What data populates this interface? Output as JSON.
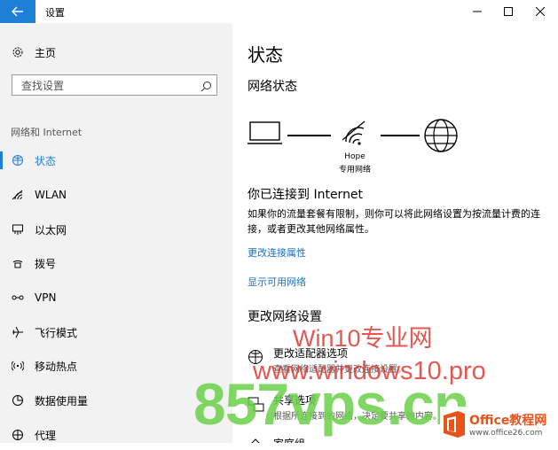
{
  "window": {
    "title": "设置"
  },
  "sidebar": {
    "home_label": "主页",
    "search_placeholder": "查找设置",
    "section_title": "网络和 Internet",
    "items": [
      {
        "label": "状态",
        "icon": "status-icon",
        "selected": true
      },
      {
        "label": "WLAN",
        "icon": "wifi-icon"
      },
      {
        "label": "以太网",
        "icon": "ethernet-icon"
      },
      {
        "label": "拨号",
        "icon": "dialup-icon"
      },
      {
        "label": "VPN",
        "icon": "vpn-icon"
      },
      {
        "label": "飞行模式",
        "icon": "airplane-icon"
      },
      {
        "label": "移动热点",
        "icon": "hotspot-icon"
      },
      {
        "label": "数据使用量",
        "icon": "data-usage-icon"
      },
      {
        "label": "代理",
        "icon": "proxy-icon"
      }
    ]
  },
  "main": {
    "page_title": "状态",
    "network_status_heading": "网络状态",
    "network_name": "Hope",
    "network_type": "专用网络",
    "connected_heading": "你已连接到 Internet",
    "connected_desc": "如果你的流量套餐有限制，则你可以将此网络设置为按流量计费的连接，或者更改其他网络属性。",
    "link_change_properties": "更改连接属性",
    "link_show_networks": "显示可用网络",
    "change_settings_heading": "更改网络设置",
    "options": [
      {
        "title": "更改适配器选项",
        "desc": "查看网络适配器并更改连接设置。",
        "icon": "adapter-icon"
      },
      {
        "title": "共享选项",
        "desc": "根据所连接到的网络，决定要共享的内容。",
        "icon": "sharing-icon"
      },
      {
        "title": "家庭组",
        "icon": "homegroup-icon"
      }
    ]
  },
  "watermark": {
    "line1": "Win10专业网",
    "line2": "www.windows10.pro",
    "line3": "857vps.cn",
    "brand_name": "Office教程网",
    "brand_url": "www.office26.com"
  },
  "colors": {
    "accent": "#1e7fd6",
    "link": "#1a6fc4",
    "sidebar_bg": "#f2f2f2",
    "watermark_red": "#e0332b",
    "watermark_green": "#6bd14a",
    "brand_orange": "#e8531b"
  }
}
